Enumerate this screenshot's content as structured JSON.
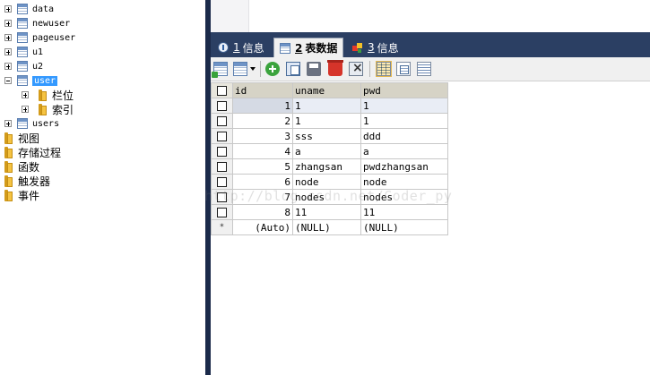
{
  "tree": {
    "tables": [
      {
        "label": "data"
      },
      {
        "label": "newuser"
      },
      {
        "label": "pageuser"
      },
      {
        "label": "u1"
      },
      {
        "label": "u2"
      },
      {
        "label": "user",
        "selected": true,
        "children": [
          {
            "label": "栏位"
          },
          {
            "label": "索引"
          }
        ]
      },
      {
        "label": "users"
      }
    ],
    "folders": [
      {
        "label": "视图"
      },
      {
        "label": "存储过程"
      },
      {
        "label": "函数"
      },
      {
        "label": "触发器"
      },
      {
        "label": "事件"
      }
    ]
  },
  "tabs": [
    {
      "num": "1",
      "label": "信息",
      "icon": "info-icon",
      "active": false
    },
    {
      "num": "2",
      "label": "表数据",
      "icon": "table-icon",
      "active": true
    },
    {
      "num": "3",
      "label": "信息",
      "icon": "colored-squares-icon",
      "active": false
    }
  ],
  "toolbar": {
    "icons": [
      "insert-row-icon",
      "export-icon",
      "add-icon",
      "copy-icon",
      "save-icon",
      "delete-icon",
      "cancel-icon",
      "grid-view-icon",
      "form-view-icon",
      "text-view-icon"
    ]
  },
  "grid": {
    "columns": [
      "id",
      "uname",
      "pwd"
    ],
    "rows": [
      {
        "id": "1",
        "uname": "1",
        "pwd": "1"
      },
      {
        "id": "2",
        "uname": "1",
        "pwd": "1"
      },
      {
        "id": "3",
        "uname": "sss",
        "pwd": "ddd"
      },
      {
        "id": "4",
        "uname": "a",
        "pwd": "a"
      },
      {
        "id": "5",
        "uname": "zhangsan",
        "pwd": "pwdzhangsan"
      },
      {
        "id": "6",
        "uname": "node",
        "pwd": "node"
      },
      {
        "id": "7",
        "uname": "nodes",
        "pwd": "nodes"
      },
      {
        "id": "8",
        "uname": "11",
        "pwd": "11"
      }
    ],
    "new_row": {
      "marker": "*",
      "id": "(Auto)",
      "uname": "(NULL)",
      "pwd": "(NULL)"
    }
  },
  "watermark": "http://blog.csdn.net/Coder_py"
}
